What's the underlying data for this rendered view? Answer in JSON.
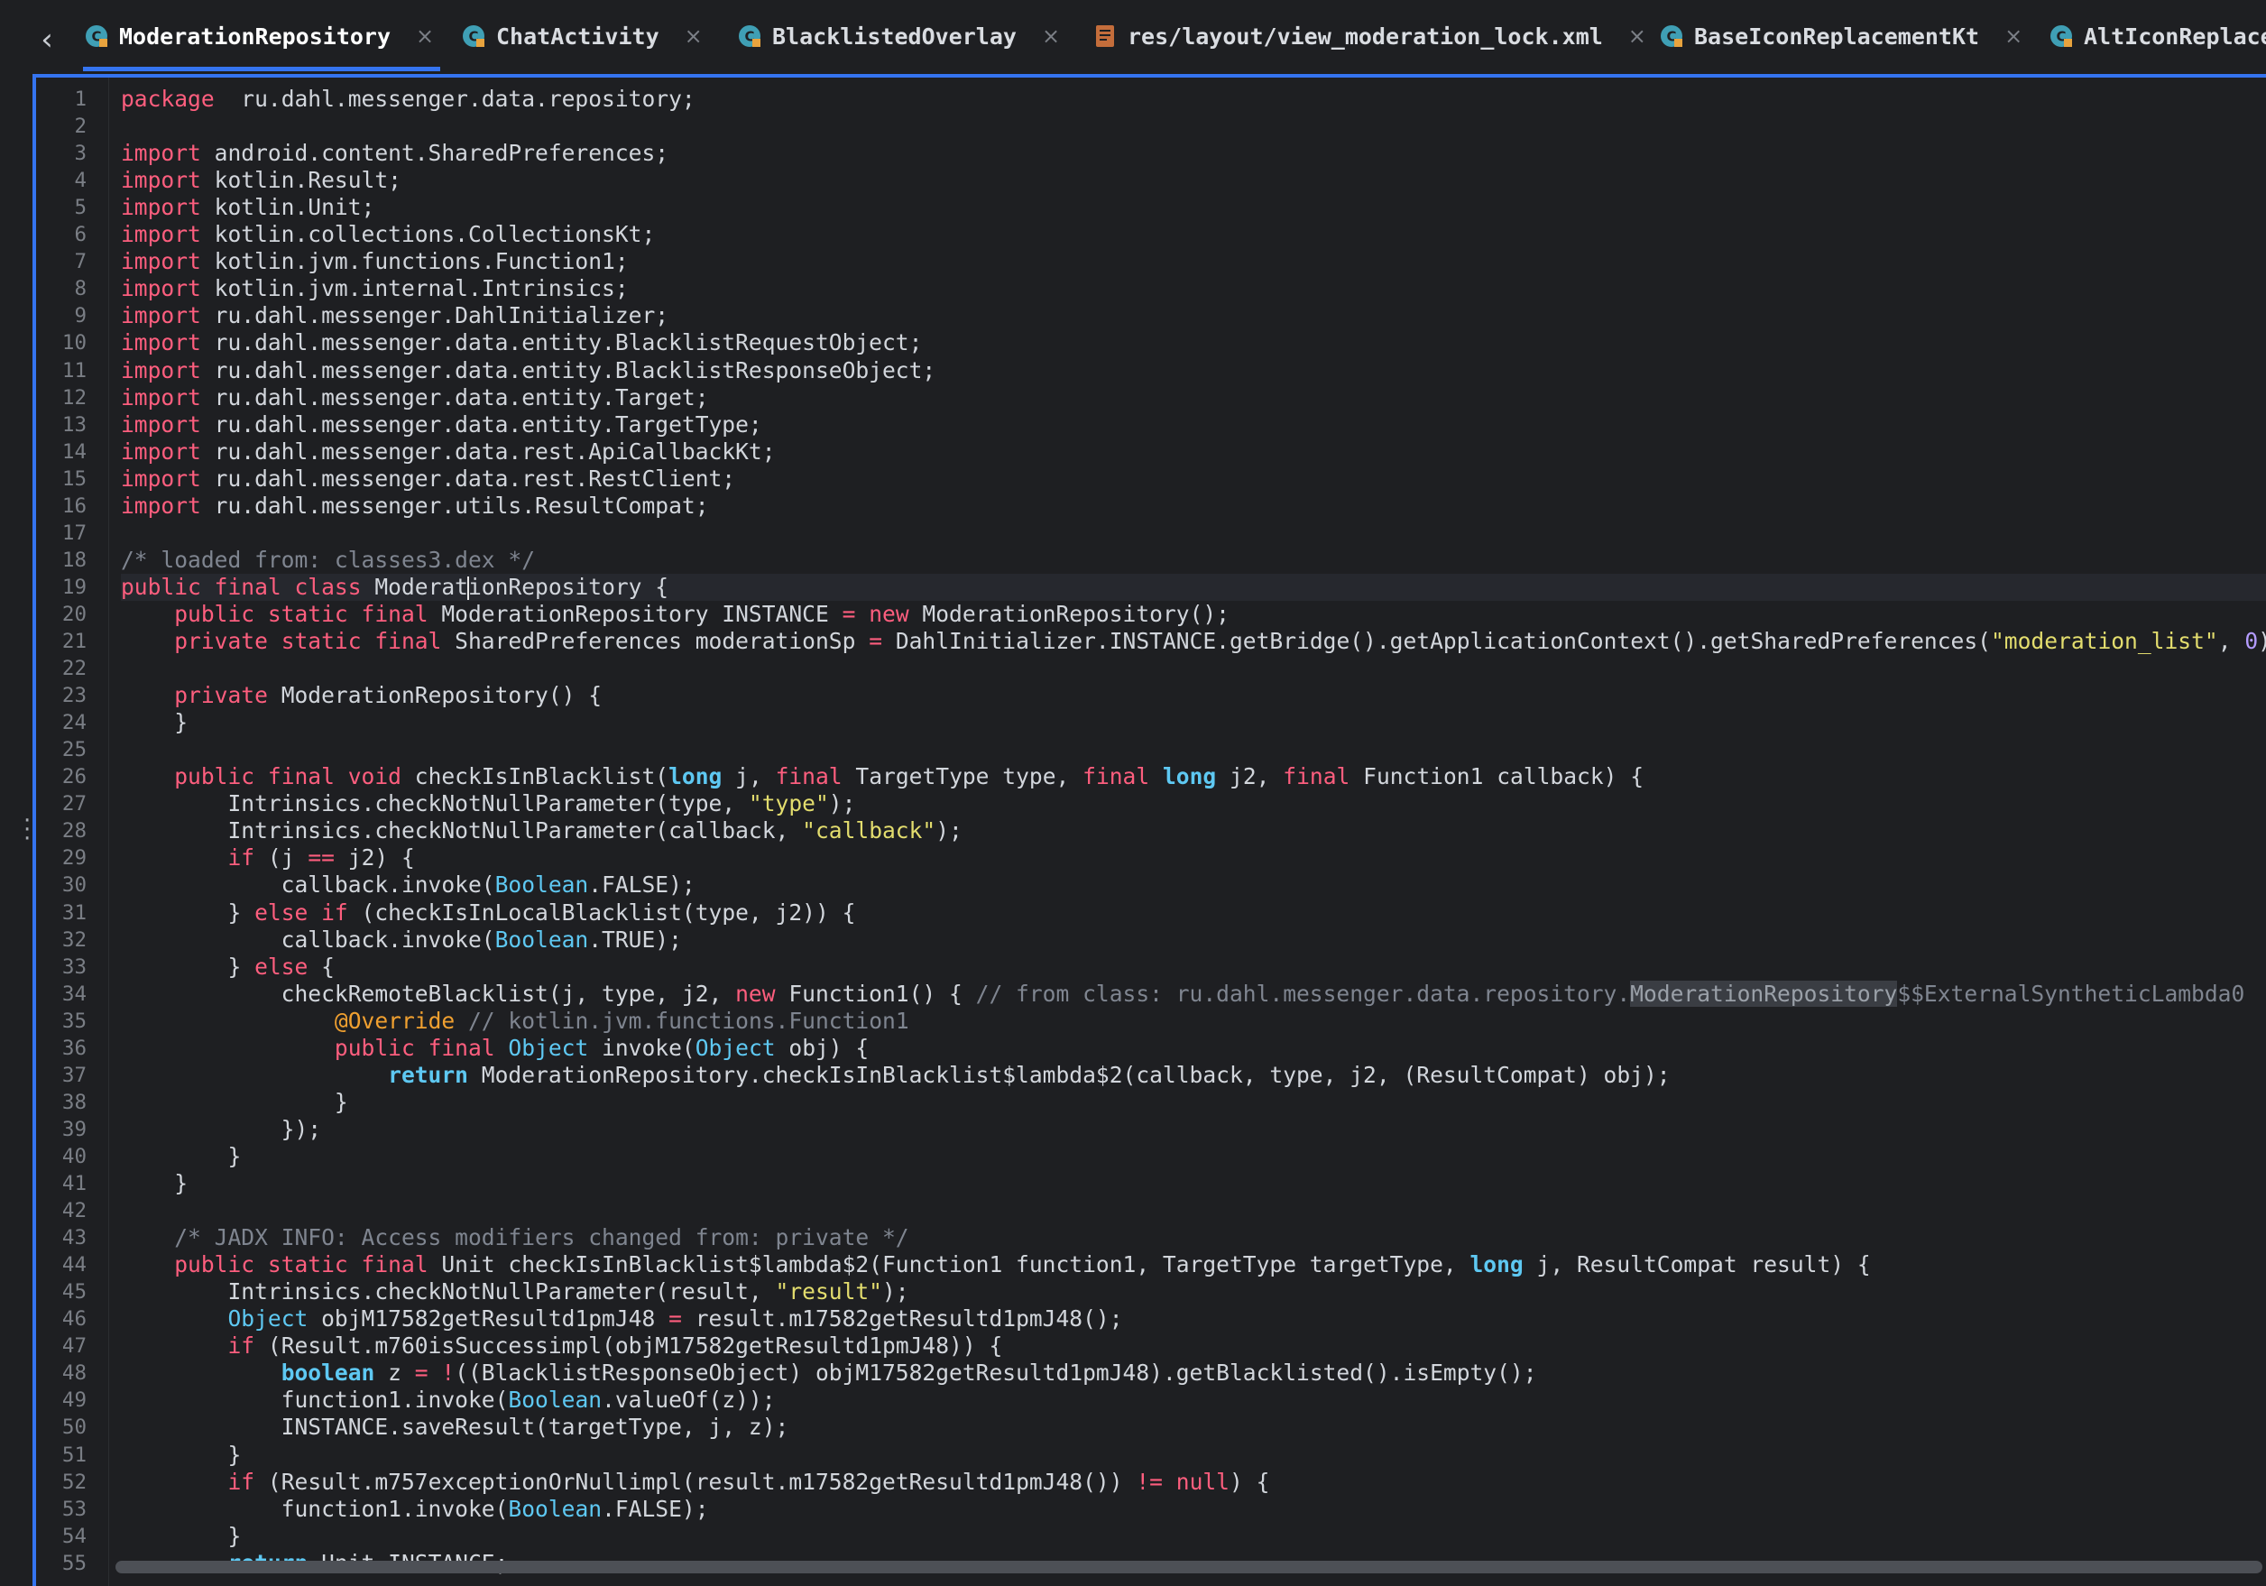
{
  "tabs": [
    {
      "label": "ModerationRepository",
      "icon": "kotlin-class-icon",
      "active": true
    },
    {
      "label": "ChatActivity",
      "icon": "kotlin-class-icon",
      "active": false
    },
    {
      "label": "BlacklistedOverlay",
      "icon": "kotlin-class-icon",
      "active": false
    },
    {
      "label": "res/layout/view_moderation_lock.xml",
      "icon": "xml-layout-icon",
      "active": false
    },
    {
      "label": "BaseIconReplacementKt",
      "icon": "kotlin-class-icon",
      "active": false
    },
    {
      "label": "AltIconReplace",
      "icon": "kotlin-class-icon",
      "active": false
    }
  ],
  "tab_close_glyph": "×",
  "back_glyph": "‹",
  "line_numbers": [
    "1",
    "2",
    "3",
    "4",
    "5",
    "6",
    "7",
    "8",
    "9",
    "10",
    "11",
    "12",
    "13",
    "14",
    "15",
    "16",
    "17",
    "18",
    "19",
    "20",
    "21",
    "22",
    "23",
    "24",
    "25",
    "26",
    "27",
    "28",
    "29",
    "30",
    "31",
    "32",
    "33",
    "34",
    "35",
    "36",
    "37",
    "38",
    "39",
    "40",
    "41",
    "42",
    "43",
    "44",
    "45",
    "46",
    "47",
    "48",
    "49",
    "50",
    "51",
    "52",
    "53",
    "54",
    "55"
  ],
  "code_lines": [
    [
      [
        "kw",
        "package"
      ],
      [
        "",
        "  ru.dahl.messenger.data.repository;"
      ]
    ],
    [],
    [
      [
        "kw",
        "import"
      ],
      [
        "",
        " android.content.SharedPreferences;"
      ]
    ],
    [
      [
        "kw",
        "import"
      ],
      [
        "",
        " kotlin.Result;"
      ]
    ],
    [
      [
        "kw",
        "import"
      ],
      [
        "",
        " kotlin.Unit;"
      ]
    ],
    [
      [
        "kw",
        "import"
      ],
      [
        "",
        " kotlin.collections.CollectionsKt;"
      ]
    ],
    [
      [
        "kw",
        "import"
      ],
      [
        "",
        " kotlin.jvm.functions.Function1;"
      ]
    ],
    [
      [
        "kw",
        "import"
      ],
      [
        "",
        " kotlin.jvm.internal.Intrinsics;"
      ]
    ],
    [
      [
        "kw",
        "import"
      ],
      [
        "",
        " ru.dahl.messenger.DahlInitializer;"
      ]
    ],
    [
      [
        "kw",
        "import"
      ],
      [
        "",
        " ru.dahl.messenger.data.entity.BlacklistRequestObject;"
      ]
    ],
    [
      [
        "kw",
        "import"
      ],
      [
        "",
        " ru.dahl.messenger.data.entity.BlacklistResponseObject;"
      ]
    ],
    [
      [
        "kw",
        "import"
      ],
      [
        "",
        " ru.dahl.messenger.data.entity.Target;"
      ]
    ],
    [
      [
        "kw",
        "import"
      ],
      [
        "",
        " ru.dahl.messenger.data.entity.TargetType;"
      ]
    ],
    [
      [
        "kw",
        "import"
      ],
      [
        "",
        " ru.dahl.messenger.data.rest.ApiCallbackKt;"
      ]
    ],
    [
      [
        "kw",
        "import"
      ],
      [
        "",
        " ru.dahl.messenger.data.rest.RestClient;"
      ]
    ],
    [
      [
        "kw",
        "import"
      ],
      [
        "",
        " ru.dahl.messenger.utils.ResultCompat;"
      ]
    ],
    [],
    [
      [
        "cmt",
        "/* loaded from: classes3.dex */"
      ]
    ],
    [
      [
        "kw",
        "public final class"
      ],
      [
        "",
        " Moderat"
      ],
      [
        "caret",
        ""
      ],
      [
        "",
        "ionRepository {"
      ]
    ],
    [
      [
        "",
        "    "
      ],
      [
        "kw",
        "public static final"
      ],
      [
        "",
        " ModerationRepository INSTANCE "
      ],
      [
        "kw",
        "="
      ],
      [
        "",
        " "
      ],
      [
        "kw",
        "new"
      ],
      [
        "",
        " ModerationRepository();"
      ]
    ],
    [
      [
        "",
        "    "
      ],
      [
        "kw",
        "private static final"
      ],
      [
        "",
        " SharedPreferences moderationSp "
      ],
      [
        "kw",
        "="
      ],
      [
        "",
        " DahlInitializer.INSTANCE.getBridge().getApplicationContext().getSharedPreferences("
      ],
      [
        "str",
        "\"moderation_list\""
      ],
      [
        "",
        ", "
      ],
      [
        "num",
        "0"
      ],
      [
        "",
        ");"
      ]
    ],
    [],
    [
      [
        "",
        "    "
      ],
      [
        "kw",
        "private"
      ],
      [
        "",
        " ModerationRepository() {"
      ]
    ],
    [
      [
        "",
        "    }"
      ]
    ],
    [],
    [
      [
        "",
        "    "
      ],
      [
        "kw",
        "public final void"
      ],
      [
        "",
        " checkIsInBlacklist("
      ],
      [
        "kwb",
        "long"
      ],
      [
        "",
        " j, "
      ],
      [
        "kw",
        "final"
      ],
      [
        "",
        " TargetType type, "
      ],
      [
        "kw",
        "final"
      ],
      [
        "",
        " "
      ],
      [
        "kwb",
        "long"
      ],
      [
        "",
        " j2, "
      ],
      [
        "kw",
        "final"
      ],
      [
        "",
        " Function1 callback) {"
      ]
    ],
    [
      [
        "",
        "        Intrinsics.checkNotNullParameter(type, "
      ],
      [
        "str",
        "\"type\""
      ],
      [
        "",
        ");"
      ]
    ],
    [
      [
        "",
        "        Intrinsics.checkNotNullParameter(callback, "
      ],
      [
        "str",
        "\"callback\""
      ],
      [
        "",
        ");"
      ]
    ],
    [
      [
        "",
        "        "
      ],
      [
        "kw",
        "if"
      ],
      [
        "",
        " (j "
      ],
      [
        "kw",
        "=="
      ],
      [
        "",
        " j2) {"
      ]
    ],
    [
      [
        "",
        "            callback.invoke("
      ],
      [
        "typ",
        "Boolean"
      ],
      [
        "",
        ".FALSE);"
      ]
    ],
    [
      [
        "",
        "        } "
      ],
      [
        "kw",
        "else if"
      ],
      [
        "",
        " (checkIsInLocalBlacklist(type, j2)) {"
      ]
    ],
    [
      [
        "",
        "            callback.invoke("
      ],
      [
        "typ",
        "Boolean"
      ],
      [
        "",
        ".TRUE);"
      ]
    ],
    [
      [
        "",
        "        } "
      ],
      [
        "kw",
        "else"
      ],
      [
        "",
        " {"
      ]
    ],
    [
      [
        "",
        "            checkRemoteBlacklist(j, type, j2, "
      ],
      [
        "kw",
        "new"
      ],
      [
        "",
        " Function1() { "
      ],
      [
        "cmt",
        "// from class: ru.dahl.messenger.data.repository."
      ],
      [
        "hl",
        "ModerationRepository"
      ],
      [
        "cmt",
        "$$ExternalSyntheticLambda0"
      ]
    ],
    [
      [
        "",
        "                "
      ],
      [
        "ann",
        "@Override"
      ],
      [
        "",
        " "
      ],
      [
        "cmt",
        "// kotlin.jvm.functions.Function1"
      ]
    ],
    [
      [
        "",
        "                "
      ],
      [
        "kw",
        "public final"
      ],
      [
        "",
        " "
      ],
      [
        "typ",
        "Object"
      ],
      [
        "",
        " invoke("
      ],
      [
        "typ",
        "Object"
      ],
      [
        "",
        " obj) {"
      ]
    ],
    [
      [
        "",
        "                    "
      ],
      [
        "kwb",
        "return"
      ],
      [
        "",
        " ModerationRepository.checkIsInBlacklist$lambda$2(callback, type, j2, (ResultCompat) obj);"
      ]
    ],
    [
      [
        "",
        "                }"
      ]
    ],
    [
      [
        "",
        "            });"
      ]
    ],
    [
      [
        "",
        "        }"
      ]
    ],
    [
      [
        "",
        "    }"
      ]
    ],
    [],
    [
      [
        "",
        "    "
      ],
      [
        "cmt",
        "/* JADX INFO: Access modifiers changed from: private */"
      ]
    ],
    [
      [
        "",
        "    "
      ],
      [
        "kw",
        "public static final"
      ],
      [
        "",
        " Unit checkIsInBlacklist$lambda$2(Function1 function1, TargetType targetType, "
      ],
      [
        "kwb",
        "long"
      ],
      [
        "",
        " j, ResultCompat result) {"
      ]
    ],
    [
      [
        "",
        "        Intrinsics.checkNotNullParameter(result, "
      ],
      [
        "str",
        "\"result\""
      ],
      [
        "",
        ");"
      ]
    ],
    [
      [
        "",
        "        "
      ],
      [
        "typ",
        "Object"
      ],
      [
        "",
        " objM17582getResultd1pmJ48 "
      ],
      [
        "kw",
        "="
      ],
      [
        "",
        " result.m17582getResultd1pmJ48();"
      ]
    ],
    [
      [
        "",
        "        "
      ],
      [
        "kw",
        "if"
      ],
      [
        "",
        " (Result.m760isSuccessimpl(objM17582getResultd1pmJ48)) {"
      ]
    ],
    [
      [
        "",
        "            "
      ],
      [
        "kwb",
        "boolean"
      ],
      [
        "",
        " z "
      ],
      [
        "kw",
        "= !"
      ],
      [
        "",
        "((BlacklistResponseObject) objM17582getResultd1pmJ48).getBlacklisted().isEmpty();"
      ]
    ],
    [
      [
        "",
        "            function1.invoke("
      ],
      [
        "typ",
        "Boolean"
      ],
      [
        "",
        ".valueOf(z));"
      ]
    ],
    [
      [
        "",
        "            INSTANCE.saveResult(targetType, j, z);"
      ]
    ],
    [
      [
        "",
        "        }"
      ]
    ],
    [
      [
        "",
        "        "
      ],
      [
        "kw",
        "if"
      ],
      [
        "",
        " (Result.m757exceptionOrNullimpl(result.m17582getResultd1pmJ48()) "
      ],
      [
        "kw",
        "!= null"
      ],
      [
        "",
        ") {"
      ]
    ],
    [
      [
        "",
        "            function1.invoke("
      ],
      [
        "typ",
        "Boolean"
      ],
      [
        "",
        ".FALSE);"
      ]
    ],
    [
      [
        "",
        "        }"
      ]
    ],
    [
      [
        "",
        "        "
      ],
      [
        "kwb",
        "return"
      ],
      [
        "",
        " Unit.INSTANCE;"
      ]
    ]
  ],
  "caret_line": 19,
  "colors": {
    "accent": "#3574f0",
    "keyword": "#fd5e7e",
    "type": "#5ec8f2",
    "string": "#e3dd6e",
    "number": "#b49cff",
    "comment": "#7f8590",
    "annotation": "#f0a030"
  }
}
